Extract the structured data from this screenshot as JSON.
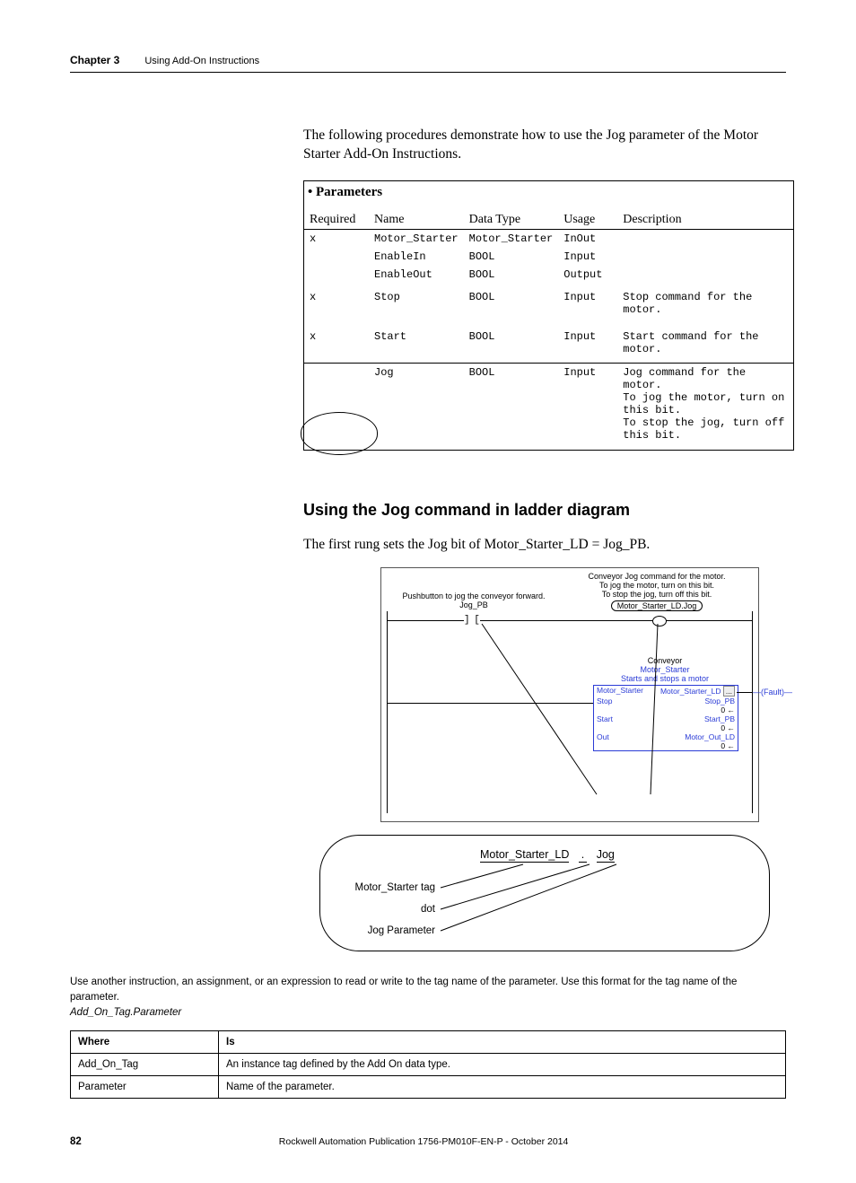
{
  "header": {
    "chapter": "Chapter 3",
    "title": "Using Add-On Instructions"
  },
  "intro": "The following procedures demonstrate how to use the Jog parameter of the Motor Starter Add-On Instructions.",
  "params": {
    "title": "• Parameters",
    "columns": [
      "Required",
      "Name",
      "Data Type",
      "Usage",
      "Description"
    ],
    "rows": [
      {
        "req": "x",
        "name": "Motor_Starter",
        "dtype": "Motor_Starter",
        "usage": "InOut",
        "desc": ""
      },
      {
        "req": "",
        "name": "EnableIn",
        "dtype": "BOOL",
        "usage": "Input",
        "desc": ""
      },
      {
        "req": "",
        "name": "EnableOut",
        "dtype": "BOOL",
        "usage": "Output",
        "desc": ""
      },
      {
        "req": "x",
        "name": "Stop",
        "dtype": "BOOL",
        "usage": "Input",
        "desc": "Stop command for the motor."
      },
      {
        "req": "x",
        "name": "Start",
        "dtype": "BOOL",
        "usage": "Input",
        "desc": "Start command for the motor."
      },
      {
        "req": "",
        "name": "Jog",
        "dtype": "BOOL",
        "usage": "Input",
        "desc": "Jog command for the motor.\nTo jog the motor, turn on this bit.\nTo stop the jog, turn off this bit."
      }
    ]
  },
  "section_h": "Using the Jog command in ladder diagram",
  "section_p": "The first rung sets the Jog bit of Motor_Starter_LD = Jog_PB.",
  "ladder": {
    "left_caption": "Pushbutton to jog the conveyor forward.",
    "left_tag": "Jog_PB",
    "right_caption_l1": "Conveyor Jog command for the motor.",
    "right_caption_l2": "To jog the motor, turn on this bit.",
    "right_caption_l3": "To stop the jog, turn off this bit.",
    "right_tag": "Motor_Starter_LD.Jog",
    "block_top1": "Conveyor",
    "block_top2": "Motor_Starter",
    "block_top3": "Starts and stops a motor",
    "fields": [
      {
        "l": "Motor_Starter",
        "r": "Motor_Starter_LD",
        "btn": "..."
      },
      {
        "l": "Stop",
        "r": "Stop_PB",
        "v": "0 ←"
      },
      {
        "l": "Start",
        "r": "Start_PB",
        "v": "0 ←"
      },
      {
        "l": "Out",
        "r": "Motor_Out_LD",
        "v": "0 ←"
      }
    ],
    "fault": "(Fault)"
  },
  "breakdown": {
    "expr_a": "Motor_Starter_LD",
    "expr_dot": ".",
    "expr_b": "Jog",
    "lbl_tag": "Motor_Starter tag",
    "lbl_dot": "dot",
    "lbl_param": "Jog Parameter"
  },
  "note_line": "Use another instruction, an assignment, or an expression to read or write to the tag name of the parameter. Use this format for the tag name of the parameter.",
  "note_italic": "Add_On_Tag.Parameter",
  "where_table": {
    "h1": "Where",
    "h2": "Is",
    "rows": [
      {
        "a": "Add_On_Tag",
        "b": "An instance tag defined by the Add On data type."
      },
      {
        "a": "Parameter",
        "b": "Name of the parameter."
      }
    ]
  },
  "footer": {
    "page": "82",
    "pub": "Rockwell Automation Publication 1756-PM010F-EN-P - October 2014"
  }
}
